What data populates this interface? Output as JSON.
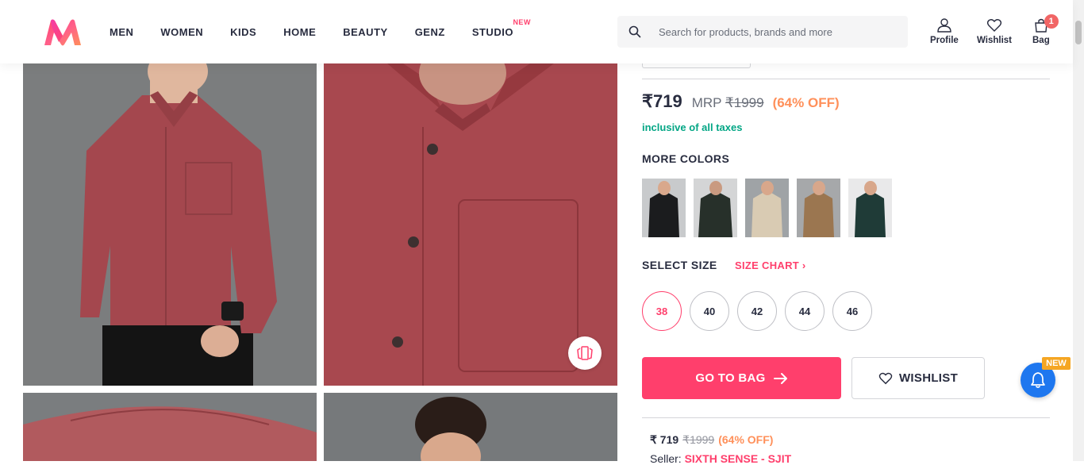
{
  "header": {
    "logo_icon": "myntra-logo",
    "nav": [
      "MEN",
      "WOMEN",
      "KIDS",
      "HOME",
      "BEAUTY",
      "GENZ",
      "STUDIO"
    ],
    "studio_badge": "NEW",
    "search_placeholder": "Search for products, brands and more",
    "profile_label": "Profile",
    "wishlist_label": "Wishlist",
    "bag_label": "Bag",
    "bag_count": "1"
  },
  "product": {
    "price": "₹719",
    "mrp_label": "MRP",
    "mrp_value": "₹1999",
    "discount": "(64% OFF)",
    "tax_note": "inclusive of all taxes",
    "more_colors_title": "MORE COLORS",
    "color_swatches": [
      "#1b1c1e",
      "#27302a",
      "#d9cbb3",
      "#9b7650",
      "#1f3b37"
    ],
    "select_size_title": "SELECT SIZE",
    "size_chart_label": "SIZE CHART",
    "sizes": [
      "38",
      "40",
      "42",
      "44",
      "46"
    ],
    "selected_size": "38",
    "go_to_bag_label": "GO TO BAG",
    "wishlist_button_label": "WISHLIST",
    "offer_price": "₹ 719",
    "offer_mrp": "₹1999",
    "offer_discount": "(64% OFF)",
    "seller_label": "Seller:",
    "seller_name": "SIXTH SENSE - SJIT"
  },
  "widgets": {
    "notification_new_tag": "NEW"
  },
  "colors": {
    "brand_pink": "#ff3f6c",
    "discount_orange": "#ff905a",
    "tax_green": "#03a685",
    "bell_blue": "#1e77ef"
  }
}
